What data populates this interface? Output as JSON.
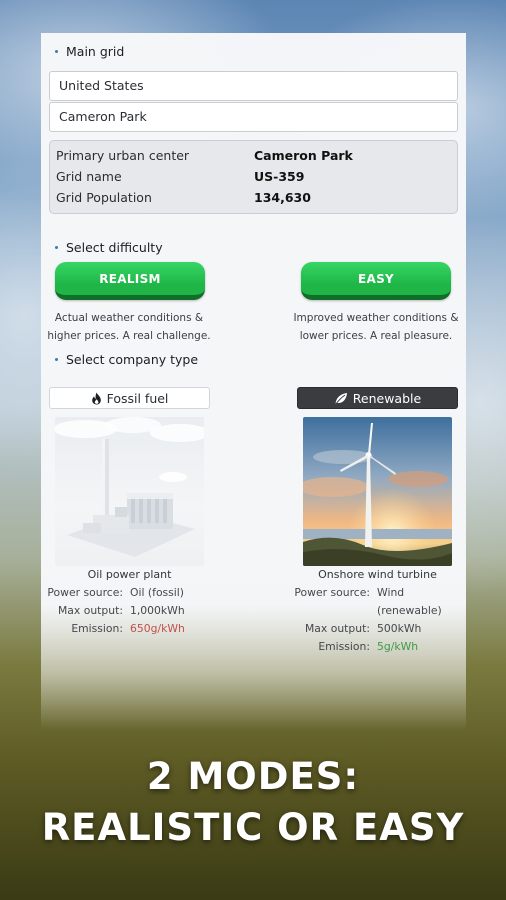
{
  "main_grid": {
    "title": "Main grid",
    "country_value": "United States",
    "city_value": "Cameron Park",
    "info": {
      "primary_urban_center_label": "Primary urban center",
      "primary_urban_center_value": "Cameron Park",
      "grid_name_label": "Grid name",
      "grid_name_value": "US-359",
      "grid_population_label": "Grid Population",
      "grid_population_value": "134,630"
    }
  },
  "difficulty": {
    "title": "Select difficulty",
    "realism_label": "REALISM",
    "realism_desc_1": "Actual weather conditions &",
    "realism_desc_2": "higher prices. A real challenge.",
    "easy_label": "EASY",
    "easy_desc_1": "Improved weather conditions &",
    "easy_desc_2": "lower prices. A real pleasure."
  },
  "company": {
    "title": "Select company type",
    "fossil": {
      "tag": "Fossil fuel",
      "icon": "flame-icon",
      "caption": "Oil power plant",
      "power_source_label": "Power source:",
      "power_source_value": "Oil (fossil)",
      "max_output_label": "Max output:",
      "max_output_value": "1,000kWh",
      "emission_label": "Emission:",
      "emission_value": "650g/kWh",
      "emission_color": "#c0504d"
    },
    "renewable": {
      "tag": "Renewable",
      "icon": "leaf-icon",
      "caption": "Onshore wind turbine",
      "power_source_label": "Power source:",
      "power_source_value_1": "Wind",
      "power_source_value_2": "(renewable)",
      "max_output_label": "Max output:",
      "max_output_value": "500kWh",
      "emission_label": "Emission:",
      "emission_value": "5g/kWh",
      "emission_color": "#3c9a4a"
    }
  },
  "promo": {
    "line1": "2 MODES:",
    "line2": "REALISTIC OR EASY"
  },
  "colors": {
    "button_green": "#1fb547",
    "accent_dot": "#3a7ab8",
    "renewable_tag_bg": "#3a3c40"
  }
}
